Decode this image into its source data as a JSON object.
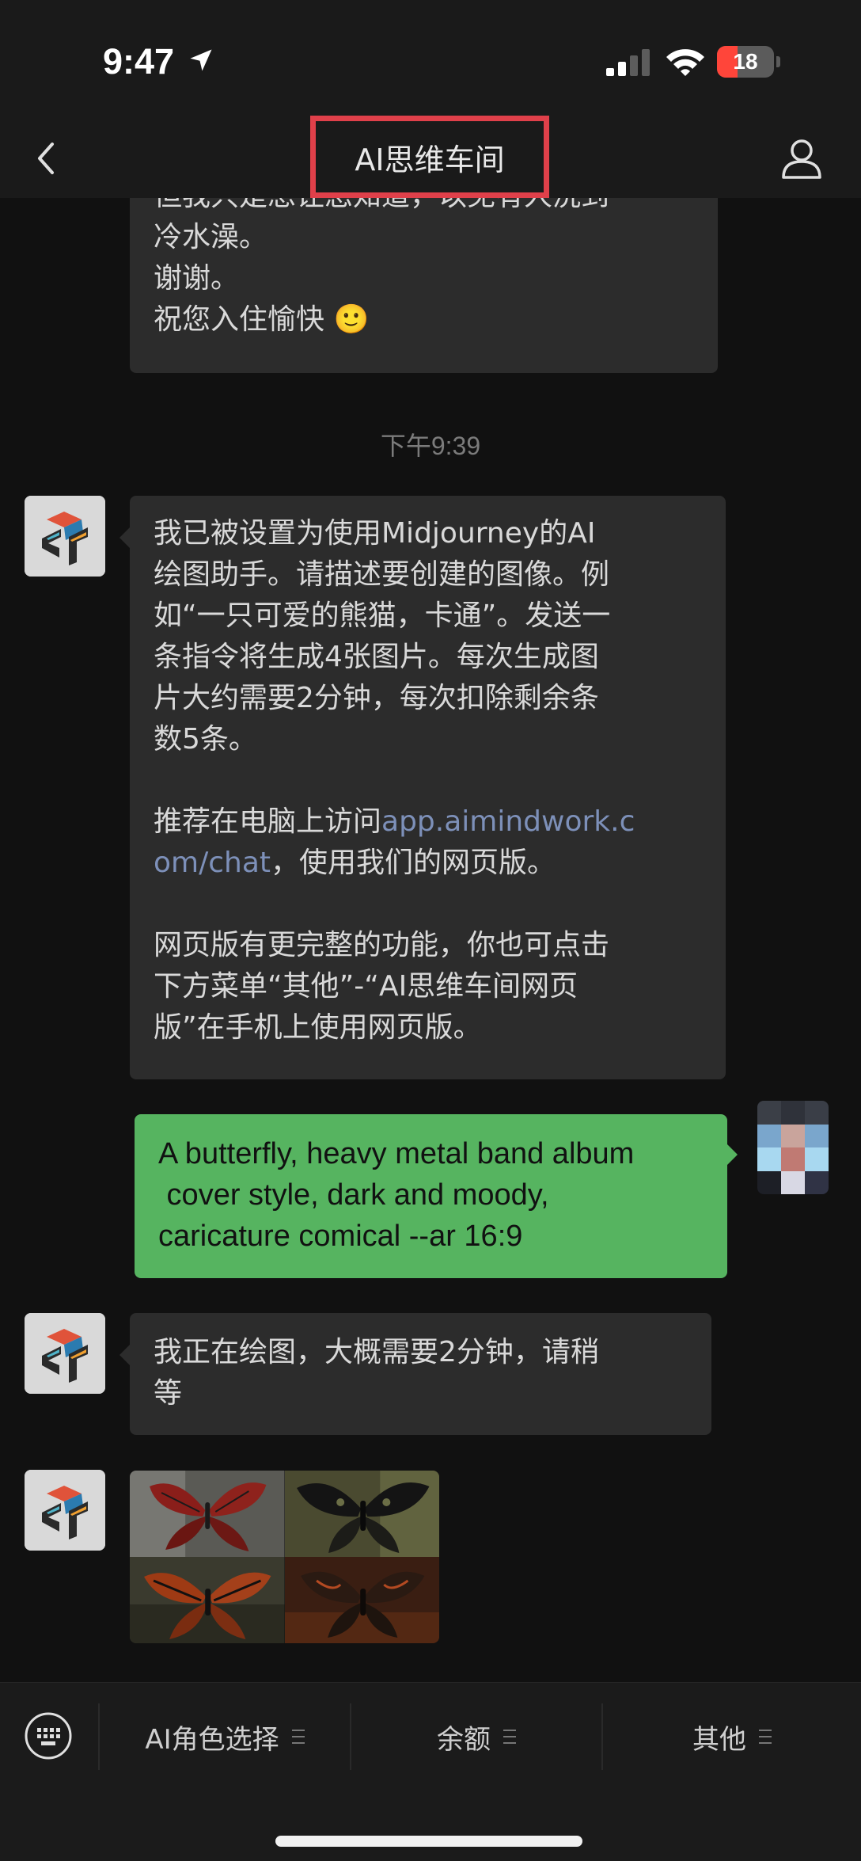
{
  "status_bar": {
    "time": "9:47",
    "battery_level": "18",
    "battery_color": "#ff453a"
  },
  "nav": {
    "title": "AI思维车间",
    "back_icon": "chevron-left-icon",
    "profile_icon": "person-icon"
  },
  "messages": {
    "prev_bot_lines": [
      "但我只是想让您知道，以免有人洗到",
      "冷水澡。",
      "谢谢。",
      "祝您入住愉快 🙂"
    ],
    "timestamp": "下午9:39",
    "bot_intro": {
      "para1": [
        "我已被设置为使用Midjourney的AI",
        "绘图助手。请描述要创建的图像。例",
        "如“一只可爱的熊猫，卡通”。发送一",
        "条指令将生成4张图片。每次生成图",
        "片大约需要2分钟，每次扣除剩余条",
        "数5条。"
      ],
      "para2_prefix": "推荐在电脑上访问",
      "link_part1": "app.aimindwork.c",
      "link_part2": "om/chat",
      "para2_suffix": "，使用我们的网页版。",
      "para3": [
        "网页版有更完整的功能，你也可点击",
        "下方菜单“其他”-“AI思维车间网页",
        "版”在手机上使用网页版。"
      ]
    },
    "user_prompt": [
      "A butterfly, heavy metal band album",
      " cover style, dark and moody,",
      "caricature comical --ar 16:9"
    ],
    "bot_wait": [
      "我正在绘图，大概需要2分钟，请稍",
      "等"
    ]
  },
  "bottom_menu": {
    "keyboard_icon": "keyboard-icon",
    "items": [
      {
        "label": "AI角色选择"
      },
      {
        "label": "余额"
      },
      {
        "label": "其他"
      }
    ]
  }
}
